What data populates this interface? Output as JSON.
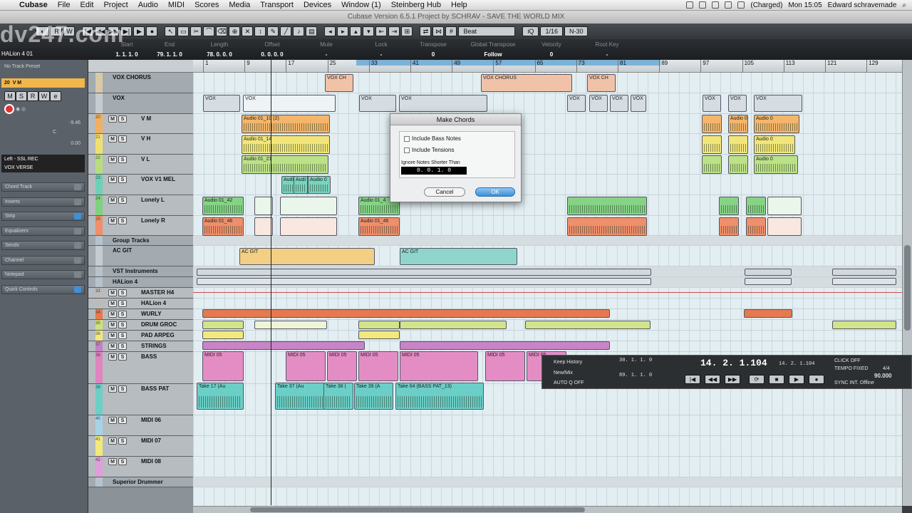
{
  "menubar": {
    "apple_symbol": "",
    "items": [
      "Cubase",
      "File",
      "Edit",
      "Project",
      "Audio",
      "MIDI",
      "Scores",
      "Media",
      "Transport",
      "Devices",
      "Window (1)",
      "Steinberg Hub",
      "Help"
    ],
    "battery": "(Charged)",
    "clock": "Mon 15:05",
    "user": "Edward schravemade"
  },
  "window_title": "Cubase Version 6.5.1 Project by SCHRAV - SAVE THE WORLD MIX",
  "watermark": "dv247.com",
  "toolbar": {
    "quantize_label": "Beat",
    "quantize_value": "1/16",
    "quantize_mode": "N-30",
    "iq_label": "iQ"
  },
  "info_line": {
    "track_label": "HALion 4 01",
    "fields": [
      {
        "header": "Start",
        "value": "1. 1. 1. 0"
      },
      {
        "header": "End",
        "value": "79. 1. 1. 0"
      },
      {
        "header": "Length",
        "value": "78. 0. 0. 0"
      },
      {
        "header": "Offset",
        "value": "0. 0. 0. 0"
      },
      {
        "header": "Mute",
        "value": "-"
      },
      {
        "header": "Lock",
        "value": "-"
      },
      {
        "header": "Transpose",
        "value": "0"
      },
      {
        "header": "Global Transpose",
        "value": "Follow"
      },
      {
        "header": "Velocity",
        "value": "0"
      },
      {
        "header": "Root Key",
        "value": "-"
      }
    ]
  },
  "inspector": {
    "preset": "No Track Preset",
    "track_number": "20",
    "track_name": "V M",
    "volume": "-9.46",
    "pan": "C",
    "delay": "0.00",
    "input": "Left - SSL REC",
    "output": "VOX VERSE",
    "sections": [
      "Chord Track",
      "Inserts",
      "Strip",
      "Equalizers",
      "Sends",
      "Channel",
      "Notepad",
      "Quick Controls"
    ]
  },
  "tracks": [
    {
      "num": "",
      "name": "VOX CHORUS",
      "color": "#d9c9a8",
      "type": "folder"
    },
    {
      "num": "",
      "name": "VOX",
      "color": "#c4ccd2",
      "type": "folder"
    },
    {
      "num": "20",
      "name": "V M",
      "color": "#f0b061",
      "type": "audio"
    },
    {
      "num": "21",
      "name": "V H",
      "color": "#f0e070",
      "type": "audio"
    },
    {
      "num": "22",
      "name": "V L",
      "color": "#b7dd7e",
      "type": "audio"
    },
    {
      "num": "23",
      "name": "VOX V1 MEL",
      "color": "#6fd0b8",
      "type": "audio"
    },
    {
      "num": "24",
      "name": "Lonely L",
      "color": "#7fd07f",
      "type": "audio"
    },
    {
      "num": "25",
      "name": "Lonely R",
      "color": "#ef8f6b",
      "type": "audio"
    },
    {
      "num": "",
      "name": "Group Tracks",
      "color": "#b7c3cc",
      "type": "folder"
    },
    {
      "num": "",
      "name": "AC GIT",
      "color": "#c4ccd2",
      "type": "folder"
    },
    {
      "num": "",
      "name": "VST Instruments",
      "color": "#b7c3cc",
      "type": "folder"
    },
    {
      "num": "",
      "name": "HALion 4",
      "color": "#b7c3cc",
      "type": "folder"
    },
    {
      "num": "33",
      "name": "MASTER H4",
      "color": "#bbbbbb",
      "type": "midi"
    },
    {
      "num": "",
      "name": "HALion 4",
      "color": "#bbbbbb",
      "type": "midi"
    },
    {
      "num": "34",
      "name": "WURLY",
      "color": "#e77a4c",
      "type": "midi"
    },
    {
      "num": "35",
      "name": "DRUM GROC",
      "color": "#cfe07a",
      "type": "midi"
    },
    {
      "num": "36",
      "name": "PAD ARPEG",
      "color": "#f2e87c",
      "type": "midi"
    },
    {
      "num": "37",
      "name": "STRINGS",
      "color": "#c283c4",
      "type": "midi"
    },
    {
      "num": "38",
      "name": "BASS",
      "color": "#e084c0",
      "type": "midi"
    },
    {
      "num": "39",
      "name": "BASS PAT",
      "color": "#6ccfc7",
      "type": "audio"
    },
    {
      "num": "40",
      "name": "MIDI 06",
      "color": "#a6d3e8",
      "type": "midi"
    },
    {
      "num": "41",
      "name": "MIDI 07",
      "color": "#f2e87c",
      "type": "midi"
    },
    {
      "num": "42",
      "name": "MIDI 08",
      "color": "#dd9fd9",
      "type": "midi"
    },
    {
      "num": "",
      "name": "Superior Drummer",
      "color": "#b7c3cc",
      "type": "folder"
    }
  ],
  "ruler": [
    "1",
    "9",
    "17",
    "25",
    "33",
    "41",
    "49",
    "57",
    "65",
    "73",
    "81",
    "89",
    "97",
    "105",
    "113",
    "121",
    "129"
  ],
  "clips": {
    "vox_chorus": [
      "VOX CH",
      "VOX CHORUS",
      "VOX CH"
    ],
    "vox": [
      "VOX",
      "VOX",
      "VOX",
      "VOX",
      "VOX",
      "VOX",
      "VOX",
      "VOX",
      "VOX",
      "VOX",
      "VOX"
    ],
    "vm": [
      "Audio 01_10 (2)",
      "Audio 0",
      "Audio 0"
    ],
    "vh": [
      "Audio 01_14",
      "Audio 0"
    ],
    "vl": [
      "Audio 01_21",
      "Audio 0"
    ],
    "vox_v1": [
      "Audi",
      "Audi",
      "Audio 0"
    ],
    "lonely_l": [
      "Audio 01_42",
      "Audio 01_4"
    ],
    "lonely_r": [
      "Audio 01_46",
      "Audio 01_46"
    ],
    "ac_git": [
      "AC GIT",
      "AC GIT"
    ],
    "bass": [
      "MIDI 05",
      "MIDI 05",
      "MIDI 05",
      "MIDI 05",
      "MIDI 05",
      "MIDI 05",
      "MIDI 05"
    ],
    "bass_pat": [
      "Take 17 (Au",
      "Take 37 (Au",
      "Take 38 (",
      "Take 39 (A",
      "Take 64 (BASS PAT_13)"
    ]
  },
  "dialog": {
    "title": "Make Chords",
    "opt1": "Include Bass Notes",
    "opt2": "Include Tensions",
    "ignore_label": "Ignore Notes Shorter Than",
    "ignore_value": "0. 0. 1. 0",
    "cancel": "Cancel",
    "ok": "OK"
  },
  "transport": {
    "keep_history": "Keep History",
    "new_mix": "New/Mix",
    "auto_q": "AUTO Q",
    "auto_q_state": "OFF",
    "left_locator": "30. 1. 1. 0",
    "right_locator": "89. 1. 1. 0",
    "position_main": "14. 2. 1.104",
    "position_secondary": "14. 2. 1.104",
    "click": "CLICK",
    "click_state": "OFF",
    "tempo": "TEMPO",
    "tempo_mode": "FIXED",
    "signature": "4/4",
    "tempo_value": "90.000",
    "sync": "SYNC",
    "sync_src": "INT.",
    "sync_state": "Offline"
  },
  "colors": {
    "selection_blue": "#7cb2d8",
    "ok_button": "#3c8fd7"
  }
}
